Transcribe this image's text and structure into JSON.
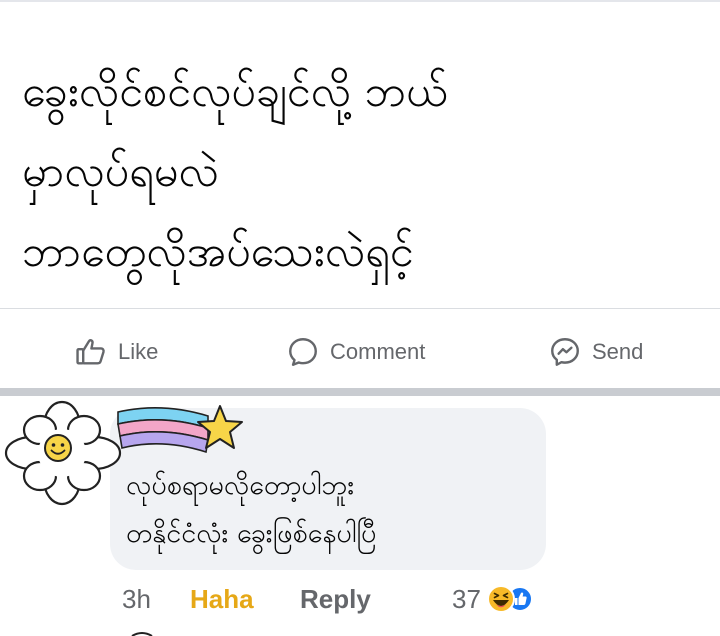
{
  "post": {
    "text_lines": [
      "ခွေးလိုင်စင်လုပ်ချင်လို့ ဘယ်",
      "မှာလုပ်ရမလဲ",
      "ဘာတွေလိုအပ်သေးလဲရှင့်"
    ]
  },
  "actions": {
    "like_label": "Like",
    "comment_label": "Comment",
    "send_label": "Send"
  },
  "comment": {
    "text_lines": [
      "လုပ်စရာမလိုတော့ပါဘူး",
      "တနိုင်ငံလုံး ခွေးဖြစ်နေပါပြီ"
    ],
    "time": "3h",
    "reaction_link": "Haha",
    "reply_label": "Reply",
    "reaction_count": "37"
  },
  "colors": {
    "text": "#050505",
    "secondary": "#65676b",
    "haha": "#e6a817",
    "bubble": "#f0f2f5",
    "like_blue": "#1877f2"
  },
  "icons": [
    "like-icon",
    "comment-icon",
    "send-icon",
    "flower-avatar-icon",
    "shooting-star-sticker",
    "haha-reaction-icon",
    "like-reaction-icon"
  ]
}
